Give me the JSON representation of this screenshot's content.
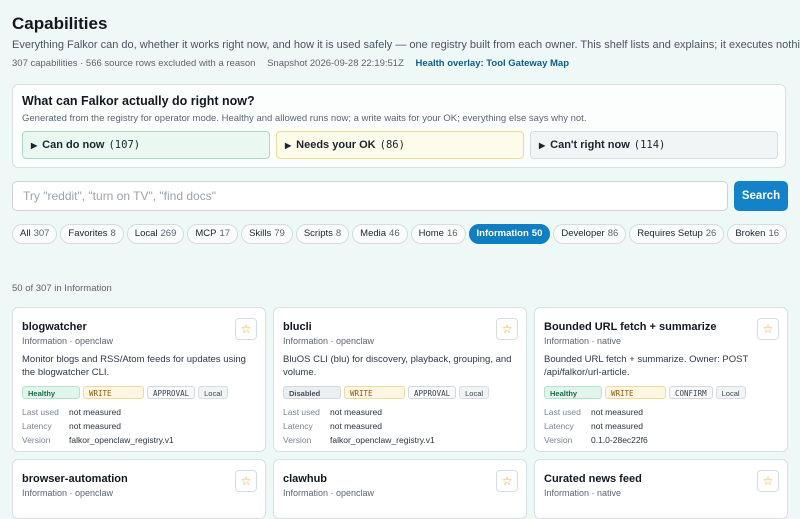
{
  "header": {
    "title": "Capabilities",
    "subtitle": "Everything Falkor can do, whether it works right now, and how it is used safely — one registry built from each owner. This shelf lists and explains; it executes nothing.",
    "stats": "307 capabilities · 566 source rows excluded with a reason",
    "snapshot": "Snapshot 2026-09-28 22:19:51Z",
    "overlay_link": "Health overlay: Tool Gateway Map"
  },
  "panel": {
    "title": "What can Falkor actually do right now?",
    "description": "Generated from the registry for operator mode. Healthy and allowed runs now; a write waits for your OK; everything else says why not.",
    "sections": [
      {
        "label": "Can do now",
        "count": "(107)"
      },
      {
        "label": "Needs your OK",
        "count": "(86)"
      },
      {
        "label": "Can't right now",
        "count": "(114)"
      }
    ]
  },
  "search": {
    "placeholder": "Try \"reddit\", \"turn on TV\", \"find docs\"",
    "button": "Search"
  },
  "filters": [
    {
      "label": "All",
      "count": "307",
      "active": false
    },
    {
      "label": "Favorites",
      "count": "8",
      "active": false
    },
    {
      "label": "Local",
      "count": "269",
      "active": false
    },
    {
      "label": "MCP",
      "count": "17",
      "active": false
    },
    {
      "label": "Skills",
      "count": "79",
      "active": false
    },
    {
      "label": "Scripts",
      "count": "8",
      "active": false
    },
    {
      "label": "Media",
      "count": "46",
      "active": false
    },
    {
      "label": "Home",
      "count": "16",
      "active": false
    },
    {
      "label": "Information",
      "count": "50",
      "active": true
    },
    {
      "label": "Developer",
      "count": "86",
      "active": false
    },
    {
      "label": "Requires Setup",
      "count": "26",
      "active": false
    },
    {
      "label": "Broken",
      "count": "16",
      "active": false
    }
  ],
  "result_count": "50 of 307 in Information",
  "stat_labels": {
    "last_used": "Last used",
    "latency": "Latency",
    "version": "Version"
  },
  "colors": {
    "accent": "#0f7ec3",
    "healthy": "#1e6b46",
    "star": "#e39b1c"
  },
  "cards": [
    {
      "name": "blogwatcher",
      "sub": "Information · openclaw",
      "star": "☆",
      "description": "Monitor blogs and RSS/Atom feeds for updates using the blogwatcher CLI.",
      "status": "Healthy",
      "permission": "WRITE",
      "gate": "APPROVAL",
      "location": "Local",
      "last_used": "not measured",
      "latency": "not measured",
      "version": "falkor_openclaw_registry.v1"
    },
    {
      "name": "blucli",
      "sub": "Information · openclaw",
      "star": "☆",
      "description": "BluOS CLI (blu) for discovery, playback, grouping, and volume.",
      "status": "Disabled",
      "permission": "WRITE",
      "gate": "APPROVAL",
      "location": "Local",
      "last_used": "not measured",
      "latency": "not measured",
      "version": "falkor_openclaw_registry.v1"
    },
    {
      "name": "Bounded URL fetch + summarize",
      "sub": "Information · native",
      "star": "☆",
      "description": "Bounded URL fetch + summarize. Owner: POST /api/falkor/url-article.",
      "status": "Healthy",
      "permission": "WRITE",
      "gate": "CONFIRM",
      "location": "Local",
      "last_used": "not measured",
      "latency": "not measured",
      "version": "0.1.0-28ec22f6"
    },
    {
      "name": "browser-automation",
      "sub": "Information · openclaw",
      "star": "☆"
    },
    {
      "name": "clawhub",
      "sub": "Information · openclaw",
      "star": "☆"
    },
    {
      "name": "Curated news feed",
      "sub": "Information · native",
      "star": "☆"
    }
  ]
}
